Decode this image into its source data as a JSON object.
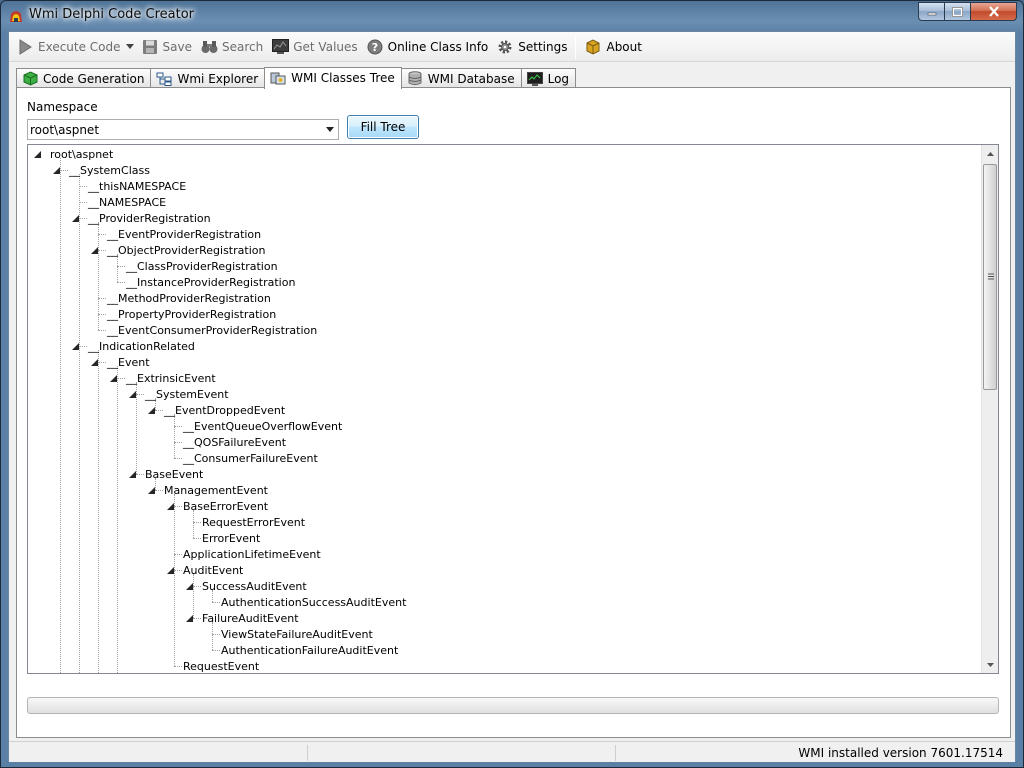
{
  "window": {
    "title": "Wmi Delphi Code Creator"
  },
  "toolbar": {
    "execute_label": "Execute Code",
    "save_label": "Save",
    "search_label": "Search",
    "get_values_label": "Get Values",
    "online_info_label": "Online Class Info",
    "settings_label": "Settings",
    "about_label": "About"
  },
  "tabs": [
    {
      "label": "Code Generation"
    },
    {
      "label": "Wmi Explorer"
    },
    {
      "label": "WMI Classes Tree"
    },
    {
      "label": "WMI Database"
    },
    {
      "label": "Log"
    }
  ],
  "namespace": {
    "label": "Namespace",
    "value": "root\\aspnet",
    "fill_button": "Fill Tree"
  },
  "tree": [
    {
      "label": "root\\aspnet",
      "depth": 0,
      "expanded": true
    },
    {
      "label": "__SystemClass",
      "depth": 1,
      "expanded": true
    },
    {
      "label": "__thisNAMESPACE",
      "depth": 2
    },
    {
      "label": "__NAMESPACE",
      "depth": 2
    },
    {
      "label": "__ProviderRegistration",
      "depth": 2,
      "expanded": true
    },
    {
      "label": "__EventProviderRegistration",
      "depth": 3
    },
    {
      "label": "__ObjectProviderRegistration",
      "depth": 3,
      "expanded": true
    },
    {
      "label": "__ClassProviderRegistration",
      "depth": 4
    },
    {
      "label": "__InstanceProviderRegistration",
      "depth": 4
    },
    {
      "label": "__MethodProviderRegistration",
      "depth": 3
    },
    {
      "label": "__PropertyProviderRegistration",
      "depth": 3
    },
    {
      "label": "__EventConsumerProviderRegistration",
      "depth": 3
    },
    {
      "label": "__IndicationRelated",
      "depth": 2,
      "expanded": true
    },
    {
      "label": "__Event",
      "depth": 3,
      "expanded": true
    },
    {
      "label": "__ExtrinsicEvent",
      "depth": 4,
      "expanded": true
    },
    {
      "label": "__SystemEvent",
      "depth": 5,
      "expanded": true
    },
    {
      "label": "__EventDroppedEvent",
      "depth": 6,
      "expanded": true
    },
    {
      "label": "__EventQueueOverflowEvent",
      "depth": 7
    },
    {
      "label": "__QOSFailureEvent",
      "depth": 7
    },
    {
      "label": "__ConsumerFailureEvent",
      "depth": 7
    },
    {
      "label": "BaseEvent",
      "depth": 5,
      "expanded": true
    },
    {
      "label": "ManagementEvent",
      "depth": 6,
      "expanded": true
    },
    {
      "label": "BaseErrorEvent",
      "depth": 7,
      "expanded": true
    },
    {
      "label": "RequestErrorEvent",
      "depth": 8
    },
    {
      "label": "ErrorEvent",
      "depth": 8
    },
    {
      "label": "ApplicationLifetimeEvent",
      "depth": 7
    },
    {
      "label": "AuditEvent",
      "depth": 7,
      "expanded": true
    },
    {
      "label": "SuccessAuditEvent",
      "depth": 8,
      "expanded": true
    },
    {
      "label": "AuthenticationSuccessAuditEvent",
      "depth": 9
    },
    {
      "label": "FailureAuditEvent",
      "depth": 8,
      "expanded": true
    },
    {
      "label": "ViewStateFailureAuditEvent",
      "depth": 9
    },
    {
      "label": "AuthenticationFailureAuditEvent",
      "depth": 9
    },
    {
      "label": "RequestEvent",
      "depth": 7
    }
  ],
  "status": {
    "right": "WMI installed version 7601.17514"
  },
  "colors": {
    "accent": "#3c7fb1",
    "title_bar": "#5b80a5",
    "tree_lines": "#a0a0a0"
  }
}
